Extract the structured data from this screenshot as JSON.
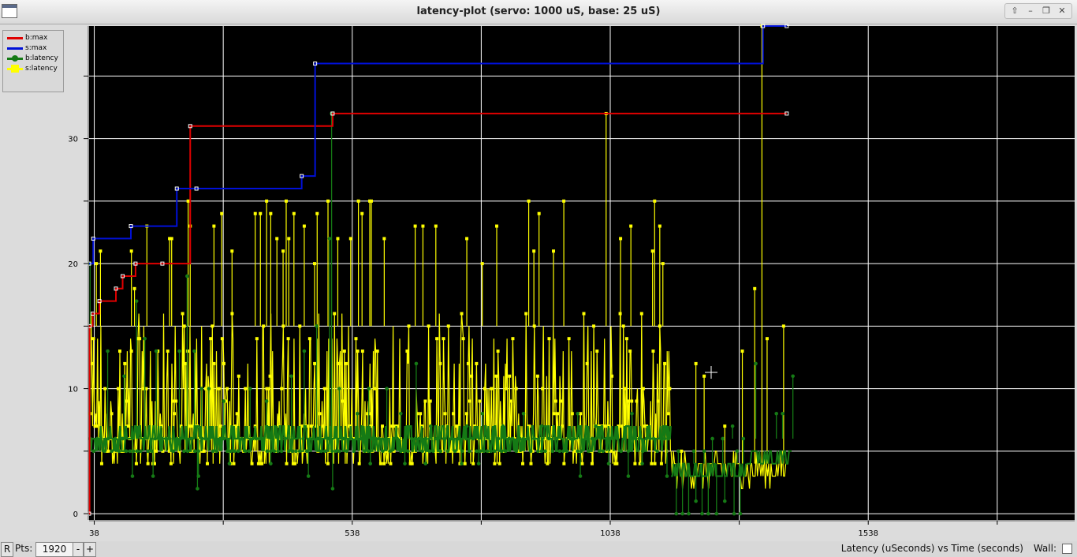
{
  "window": {
    "title": "latency-plot (servo: 1000 uS, base: 25 uS)",
    "buttons": [
      "⇧",
      "–",
      "❐",
      "✕"
    ]
  },
  "legend": [
    {
      "label": "b:max",
      "color": "#e00000",
      "marker": "none"
    },
    {
      "label": "s:max",
      "color": "#0010d8",
      "marker": "none"
    },
    {
      "label": "b:latency",
      "color": "#157a15",
      "marker": "circle"
    },
    {
      "label": "s:latency",
      "color": "#ffff00",
      "marker": "square"
    }
  ],
  "bottom": {
    "r_button": "R",
    "pts_label": "Pts:",
    "pts_value": "1920",
    "minus": "-",
    "plus": "+",
    "caption": "Latency (uSeconds) vs Time (seconds)",
    "wall_label": "Wall:"
  },
  "chart_data": {
    "type": "line",
    "background": "#000000",
    "grid": true,
    "legend_position": "top-left",
    "xlim": [
      28,
      1938
    ],
    "ylim": [
      -0.5,
      39
    ],
    "x_ticks": [
      38,
      288,
      538,
      788,
      1038,
      1288,
      1538,
      1788
    ],
    "x_tick_labels": [
      "38",
      "",
      "538",
      "",
      "1038",
      "",
      "1538",
      ""
    ],
    "y_ticks": [
      0,
      5,
      10,
      15,
      20,
      25,
      30,
      35
    ],
    "y_tick_labels": [
      "0",
      "",
      "10",
      "",
      "20",
      "",
      "30",
      ""
    ],
    "series": [
      {
        "name": "b:max",
        "color": "#e00000",
        "style": "step",
        "points": [
          [
            28,
            0
          ],
          [
            29,
            15
          ],
          [
            35,
            16
          ],
          [
            48,
            17
          ],
          [
            80,
            18
          ],
          [
            93,
            19
          ],
          [
            118,
            20
          ],
          [
            170,
            20
          ],
          [
            224,
            31
          ],
          [
            500,
            32
          ],
          [
            1380,
            32
          ]
        ]
      },
      {
        "name": "s:max",
        "color": "#0010d8",
        "style": "step",
        "points": [
          [
            28,
            20
          ],
          [
            36,
            22
          ],
          [
            109,
            23
          ],
          [
            198,
            26
          ],
          [
            236,
            26
          ],
          [
            440,
            27
          ],
          [
            466,
            36
          ],
          [
            1334,
            39
          ],
          [
            1380,
            39
          ]
        ]
      },
      {
        "name": "b:latency",
        "color": "#157a15",
        "style": "spiky",
        "marker": "circle",
        "xrange": [
          30,
          1392
        ],
        "baseline": 6,
        "spikes": [
          [
            30,
            20
          ],
          [
            64,
            13
          ],
          [
            96,
            11
          ],
          [
            120,
            17
          ],
          [
            136,
            14
          ],
          [
            158,
            13
          ],
          [
            203,
            13
          ],
          [
            218,
            19
          ],
          [
            232,
            13
          ],
          [
            246,
            10
          ],
          [
            260,
            10
          ],
          [
            289,
            9
          ],
          [
            340,
            10
          ],
          [
            372,
            9
          ],
          [
            420,
            11
          ],
          [
            445,
            13
          ],
          [
            469,
            15
          ],
          [
            494,
            22
          ],
          [
            498,
            32
          ],
          [
            513,
            10
          ],
          [
            548,
            8
          ],
          [
            570,
            10
          ],
          [
            605,
            10
          ],
          [
            632,
            8
          ],
          [
            662,
            12
          ],
          [
            690,
            7
          ],
          [
            760,
            7
          ],
          [
            790,
            8
          ],
          [
            830,
            7
          ],
          [
            870,
            8
          ],
          [
            905,
            7
          ],
          [
            975,
            8
          ],
          [
            1010,
            7
          ],
          [
            1080,
            8
          ],
          [
            1275,
            7
          ],
          [
            1320,
            12
          ],
          [
            1360,
            8
          ],
          [
            1372,
            8
          ],
          [
            1392,
            11
          ]
        ],
        "dips": [
          [
            112,
            3
          ],
          [
            152,
            3
          ],
          [
            238,
            2
          ],
          [
            240,
            3
          ],
          [
            300,
            4
          ],
          [
            380,
            4
          ],
          [
            453,
            3
          ],
          [
            500,
            2
          ],
          [
            573,
            4
          ],
          [
            640,
            4
          ],
          [
            680,
            4
          ],
          [
            750,
            4
          ],
          [
            783,
            4
          ],
          [
            980,
            3
          ],
          [
            1035,
            4
          ],
          [
            1073,
            3
          ],
          [
            1100,
            4
          ],
          [
            1148,
            3
          ]
        ],
        "low_region": {
          "x": [
            1156,
            1302
          ],
          "base": 4,
          "dips": [
            [
              1166,
              0
            ],
            [
              1178,
              0
            ],
            [
              1190,
              0
            ],
            [
              1204,
              1
            ],
            [
              1216,
              0
            ],
            [
              1228,
              0
            ],
            [
              1244,
              0
            ],
            [
              1260,
              1
            ],
            [
              1278,
              0
            ],
            [
              1290,
              0
            ]
          ],
          "spikes": [
            [
              1170,
              5
            ],
            [
              1200,
              5
            ],
            [
              1220,
              5
            ],
            [
              1236,
              6
            ],
            [
              1256,
              6
            ],
            [
              1284,
              5
            ],
            [
              1296,
              6
            ]
          ]
        }
      },
      {
        "name": "s:latency",
        "color": "#ffff00",
        "style": "dense",
        "marker": "square",
        "xrange": [
          30,
          1392
        ],
        "band": [
          5,
          16
        ],
        "spikes": [
          [
            42,
            20
          ],
          [
            50,
            21
          ],
          [
            110,
            21
          ],
          [
            116,
            18
          ],
          [
            140,
            23
          ],
          [
            184,
            22
          ],
          [
            188,
            22
          ],
          [
            220,
            25
          ],
          [
            224,
            23
          ],
          [
            270,
            23
          ],
          [
            285,
            24
          ],
          [
            305,
            21
          ],
          [
            350,
            24
          ],
          [
            360,
            24
          ],
          [
            372,
            25
          ],
          [
            380,
            24
          ],
          [
            392,
            22
          ],
          [
            404,
            21
          ],
          [
            410,
            25
          ],
          [
            415,
            22
          ],
          [
            425,
            24
          ],
          [
            445,
            23
          ],
          [
            465,
            20
          ],
          [
            470,
            24
          ],
          [
            491,
            25
          ],
          [
            510,
            22
          ],
          [
            535,
            22
          ],
          [
            550,
            25
          ],
          [
            557,
            24
          ],
          [
            572,
            25
          ],
          [
            575,
            25
          ],
          [
            600,
            22
          ],
          [
            660,
            23
          ],
          [
            675,
            23
          ],
          [
            700,
            23
          ],
          [
            760,
            22
          ],
          [
            790,
            20
          ],
          [
            818,
            23
          ],
          [
            880,
            25
          ],
          [
            890,
            21
          ],
          [
            900,
            24
          ],
          [
            928,
            21
          ],
          [
            948,
            25
          ],
          [
            1030,
            32
          ],
          [
            1058,
            22
          ],
          [
            1078,
            23
          ],
          [
            1120,
            21
          ],
          [
            1124,
            25
          ],
          [
            1134,
            23
          ],
          [
            1140,
            20
          ]
        ],
        "low_region": {
          "x": [
            1156,
            1380
          ],
          "base": 2,
          "spikes": [
            [
              1176,
              5
            ],
            [
              1204,
              12
            ],
            [
              1220,
              11
            ],
            [
              1260,
              7
            ],
            [
              1294,
              13
            ],
            [
              1318,
              18
            ],
            [
              1332,
              39
            ],
            [
              1342,
              14
            ],
            [
              1374,
              15
            ]
          ]
        }
      }
    ]
  }
}
